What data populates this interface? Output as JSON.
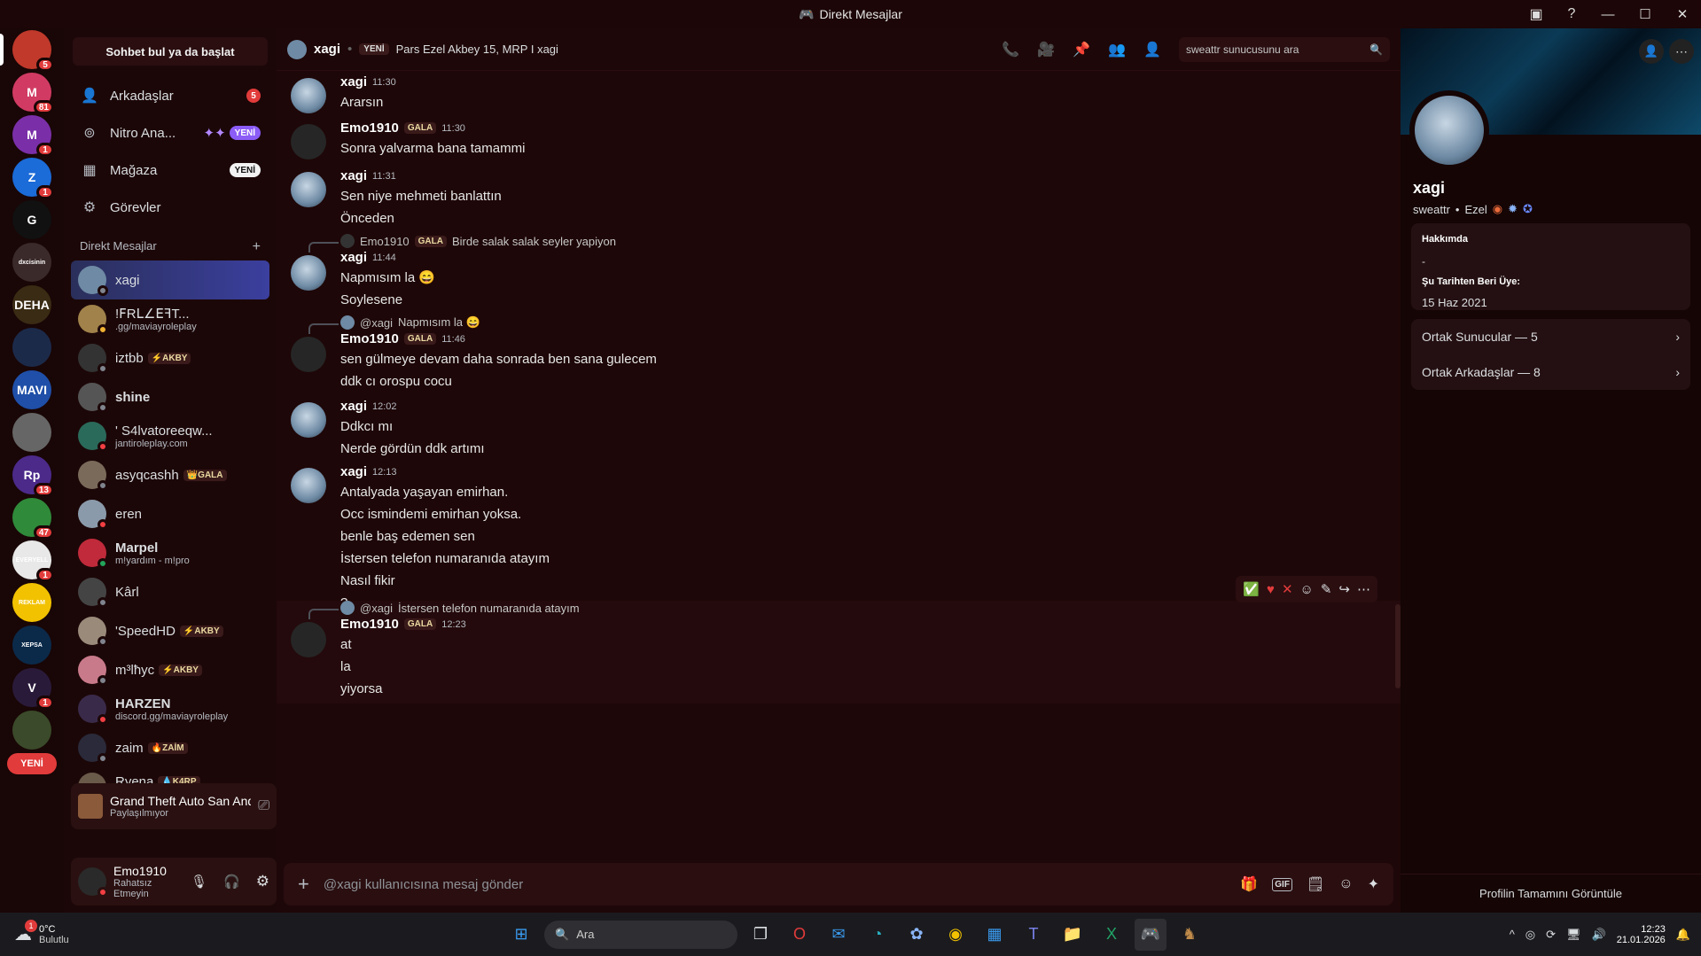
{
  "window": {
    "title": "Direkt Mesajlar"
  },
  "servers": [
    {
      "label": "",
      "color": "#c0392b",
      "badge": "5"
    },
    {
      "label": "M",
      "color": "#d13b63",
      "badge": "81"
    },
    {
      "label": "M",
      "color": "#7a2fa8",
      "badge": "1"
    },
    {
      "label": "Z",
      "color": "#1b6bd8",
      "badge": "1"
    },
    {
      "label": "G",
      "color": "#111111",
      "badge": ""
    },
    {
      "label": "dxcisinin",
      "color": "#3b2a2a",
      "badge": ""
    },
    {
      "label": "DEHA",
      "color": "#3a2b14",
      "badge": ""
    },
    {
      "label": "",
      "color": "#1c2a4a",
      "badge": ""
    },
    {
      "label": "MAVI",
      "color": "#1f4fa8",
      "badge": ""
    },
    {
      "label": "",
      "color": "#666666",
      "badge": ""
    },
    {
      "label": "Rp",
      "color": "#4b2a8a",
      "badge": "13"
    },
    {
      "label": "",
      "color": "#2f8a3a",
      "badge": "47"
    },
    {
      "label": "EVERYELL",
      "color": "#e8e8e8",
      "badge": "1"
    },
    {
      "label": "REKLAM",
      "color": "#f2c200",
      "badge": ""
    },
    {
      "label": "XEPSA",
      "color": "#0b2a4a",
      "badge": ""
    },
    {
      "label": "V",
      "color": "#2a1a3a",
      "badge": "1"
    },
    {
      "label": "",
      "color": "#3a4a2a",
      "badge": ""
    }
  ],
  "servers_yeni": "YENİ",
  "sidebar": {
    "find_button": "Sohbet bul ya da başlat",
    "nav": [
      {
        "label": "Arkadaşlar",
        "badge": "5",
        "icon": "friends-icon"
      },
      {
        "label": "Nitro Ana...",
        "badge": "YENİ",
        "icon": "nitro-icon"
      },
      {
        "label": "Mağaza",
        "badge": "YENİ",
        "icon": "shop-icon"
      },
      {
        "label": "Görevler",
        "badge": "",
        "icon": "quests-icon"
      }
    ],
    "dm_header": "Direkt Mesajlar",
    "dm_add": "+",
    "dms": [
      {
        "name": "xagi",
        "sub": "",
        "tag": "",
        "color": "#6e8aa4",
        "status": "#80848e"
      },
      {
        "name": "!╤ R L E T...",
        "display": "!ꓝRꓡ∠ꓰꟻT...",
        "sub": ".gg/maviayroleplay",
        "tag": "",
        "color": "#a0824a",
        "status": "#f0b232"
      },
      {
        "name": "iztbb",
        "sub": "",
        "tag": "⚡AKBY",
        "color": "#333333",
        "status": "#80848e"
      },
      {
        "name": "shine",
        "sub": "",
        "tag": "",
        "color": "#555555",
        "status": "#80848e"
      },
      {
        "name": "' S4lvatoreeqw...",
        "sub": "jantiroleplay.com",
        "tag": "",
        "color": "#2a6a5a",
        "status": "#f23f43"
      },
      {
        "name": "asyqcashh",
        "sub": "",
        "tag": "👑GALA",
        "color": "#7a6a5a",
        "status": "#80848e"
      },
      {
        "name": "eren",
        "sub": "",
        "tag": "",
        "color": "#8a9aaa",
        "status": "#f23f43"
      },
      {
        "name": "Marpel",
        "sub": "m!yardım - m!pro",
        "tag": "",
        "color": "#c02a3a",
        "status": "#23a55a"
      },
      {
        "name": "Kârl",
        "sub": "",
        "tag": "",
        "color": "#444444",
        "status": "#80848e"
      },
      {
        "name": "'SpeedHD",
        "sub": "",
        "tag": "⚡AKBY",
        "color": "#9a8a7a",
        "status": "#80848e"
      },
      {
        "name": "m³lħyc",
        "sub": "",
        "tag": "⚡AKBY",
        "color": "#c97a8a",
        "status": "#80848e"
      },
      {
        "name": "HARZEN",
        "sub": "discord.gg/maviayroleplay",
        "tag": "",
        "color": "#3a2a4a",
        "status": "#f23f43"
      },
      {
        "name": "zaim",
        "sub": "",
        "tag": "🔥ZAİM",
        "color": "#2a2a3a",
        "status": "#80848e"
      },
      {
        "name": "Ryena",
        "sub": "• #696",
        "tag": "💧K4RP",
        "color": "#6a5a4a",
        "status": "#80848e"
      }
    ],
    "now_playing": {
      "title": "Grand Theft Auto San And...",
      "sub": "Paylaşılmıyor"
    },
    "user": {
      "name": "Emo1910",
      "status": "Rahatsız Etmeyin"
    }
  },
  "chat": {
    "header_name": "xagi",
    "header_new": "YENİ",
    "header_desc": "Pars Ezel Akbey 15, MRP I xagi",
    "search_placeholder": "sweattr sunucusunu ara",
    "composer_placeholder": "@xagi kullanıcısına mesaj gönder",
    "messages": [
      {
        "author": "xagi",
        "tag": "",
        "time": "11:30",
        "reply": null,
        "lines": [
          "Ararsın"
        ]
      },
      {
        "author": "Emo1910",
        "tag": "GALA",
        "time": "11:30",
        "reply": null,
        "lines": [
          "Sonra yalvarma bana tamammi"
        ]
      },
      {
        "author": "xagi",
        "tag": "",
        "time": "11:31",
        "reply": null,
        "lines": [
          "Sen niye mehmeti banlattın",
          "Önceden"
        ]
      },
      {
        "author": "xagi",
        "tag": "",
        "time": "11:44",
        "reply": {
          "name": "Emo1910",
          "tag": "GALA",
          "text": "Birde salak salak seyler yapiyon"
        },
        "lines": [
          "Napmısım la 😄",
          "Soylesene"
        ]
      },
      {
        "author": "Emo1910",
        "tag": "GALA",
        "time": "11:46",
        "reply": {
          "name": "@xagi",
          "tag": "",
          "text": "Napmısım la 😄"
        },
        "lines": [
          "sen gülmeye devam daha sonrada ben sana gulecem",
          "ddk cı orospu cocu"
        ]
      },
      {
        "author": "xagi",
        "tag": "",
        "time": "12:02",
        "reply": null,
        "lines": [
          "Ddkcı mı",
          "Nerde gördün ddk artımı"
        ]
      },
      {
        "author": "xagi",
        "tag": "",
        "time": "12:13",
        "reply": null,
        "lines": [
          "Antalyada yaşayan emirhan.",
          "Occ ismindemi emirhan yoksa.",
          "benle baş edemen sen",
          "İstersen telefon numaranıda atayım",
          "Nasıl fikir",
          "?"
        ]
      },
      {
        "author": "Emo1910",
        "tag": "GALA",
        "time": "12:23",
        "reply": {
          "name": "@xagi",
          "tag": "",
          "text": "İstersen telefon numaranıda atayım"
        },
        "lines": [
          "at",
          "la",
          "yiyorsa"
        ]
      }
    ]
  },
  "profile": {
    "name": "xagi",
    "sub1": "sweattr",
    "sub2": "Ezel",
    "about_title": "Hakkımda",
    "about_text": "-",
    "member_since_title": "Şu Tarihten Beri Üye:",
    "member_since": "15 Haz 2021",
    "mutual_servers": "Ortak Sunucular — 5",
    "mutual_friends": "Ortak Arkadaşlar — 8",
    "view_full": "Profilin Tamamını Görüntüle"
  },
  "taskbar": {
    "weather_temp": "0°C",
    "weather_desc": "Bulutlu",
    "weather_badge": "1",
    "search": "Ara",
    "time": "12:23",
    "date": "21.01.2026"
  },
  "colors": {
    "accent": "#5865f2",
    "bg": "#1e0708",
    "danger": "#e23b3b"
  }
}
